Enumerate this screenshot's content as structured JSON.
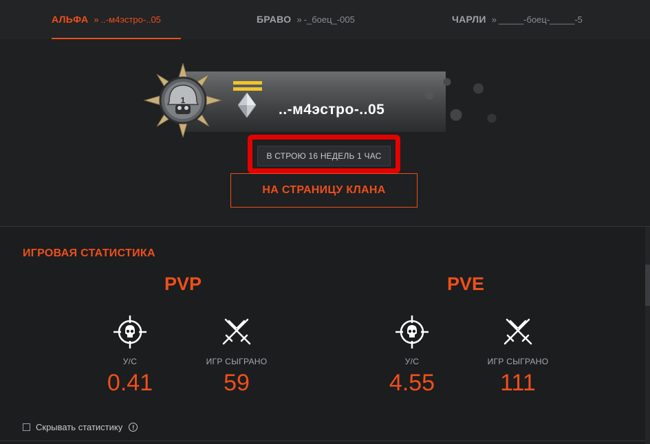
{
  "tabs": [
    {
      "name": "АЛЬФА",
      "chevron": "»",
      "player": "..-м4эстро-..05",
      "active": true
    },
    {
      "name": "БРАВО",
      "chevron": "»",
      "player": "-_боец_-005",
      "active": false
    },
    {
      "name": "ЧАРЛИ",
      "chevron": "»",
      "player": "_____-боец-_____-5",
      "active": false
    }
  ],
  "profile": {
    "player_name": "..-м4эстро-..05",
    "tenure": "В СТРОЮ 16 НЕДЕЛЬ 1 ЧАС",
    "clan_button": "НА СТРАНИЦУ КЛАНА",
    "badge_icon": "helmet-badge-icon",
    "rank_icon": "diamond-icon"
  },
  "stats": {
    "section_title": "ИГРОВАЯ СТАТИСТИКА",
    "pvp": {
      "title": "PVP",
      "kd_label": "У/С",
      "kd_value": "0.41",
      "games_label": "ИГР СЫГРАНО",
      "games_value": "59"
    },
    "pve": {
      "title": "PVE",
      "kd_label": "У/С",
      "kd_value": "4.55",
      "games_label": "ИГР СЫГРАНО",
      "games_value": "111"
    },
    "hide_label": "Скрывать статистику",
    "info_symbol": "!"
  },
  "colors": {
    "accent": "#ef4f1a",
    "highlight_frame": "#e50000",
    "rank_stripes": "#f0c52a"
  }
}
